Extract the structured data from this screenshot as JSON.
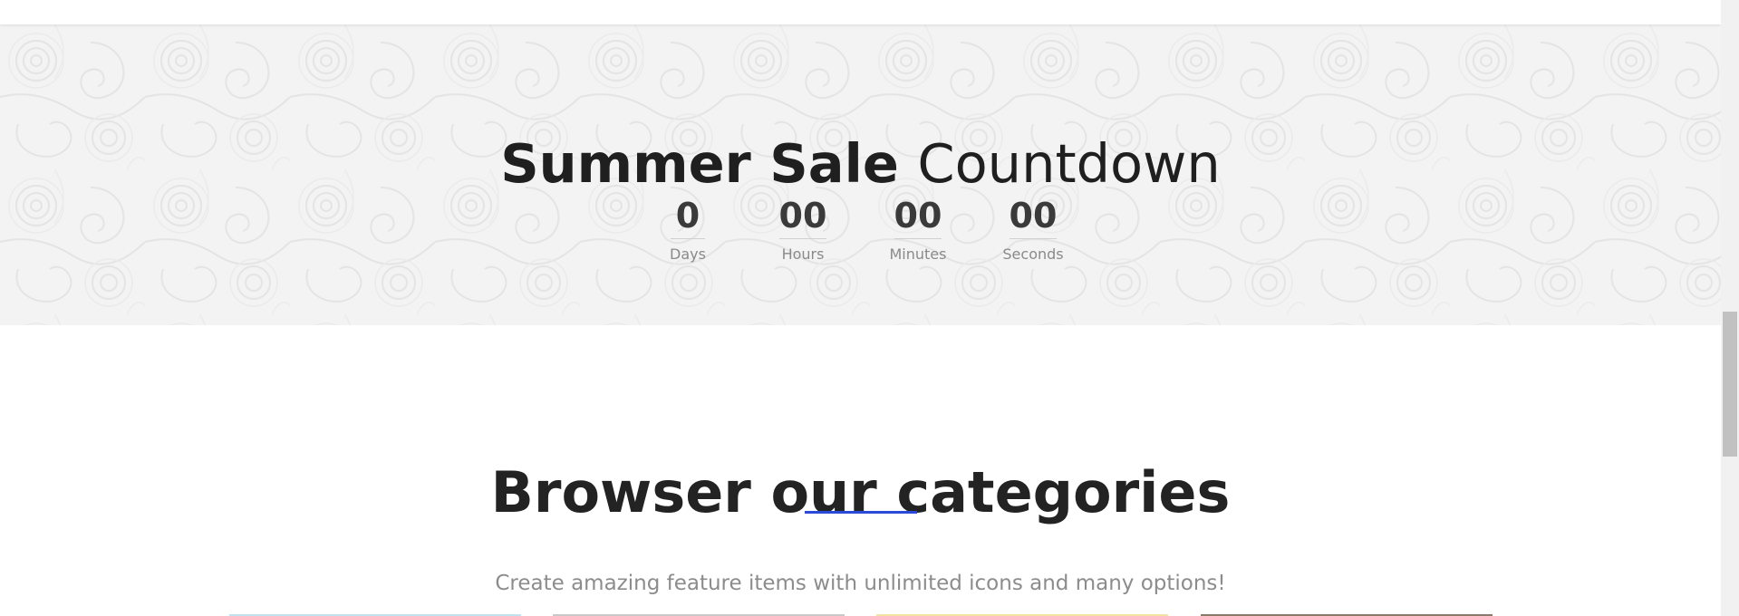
{
  "countdown": {
    "title_bold": "Summer Sale",
    "title_light": "Countdown",
    "units": [
      {
        "value": "0",
        "label": "Days"
      },
      {
        "value": "00",
        "label": "Hours"
      },
      {
        "value": "00",
        "label": "Minutes"
      },
      {
        "value": "00",
        "label": "Seconds"
      }
    ]
  },
  "categories": {
    "title": "Browser our categories",
    "subtitle": "Create amazing feature items with unlimited icons and many options!"
  },
  "colors": {
    "accent": "#2a4bd7",
    "heading": "#232323",
    "muted": "#8c8c8c",
    "section_bg": "#f2f2f2"
  }
}
